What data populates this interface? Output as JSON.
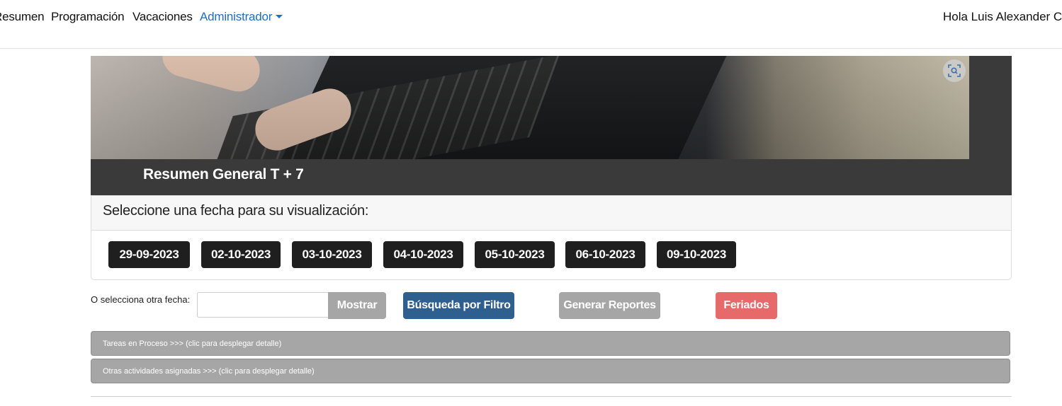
{
  "nav": {
    "items": [
      "Resumen",
      "Programación",
      "Vacaciones"
    ],
    "admin_label": "Administrador",
    "greeting": "Hola Luis Alexander Chi"
  },
  "hero": {
    "title": "Resumen General T + 7"
  },
  "date_card": {
    "title": "Seleccione una fecha para su visualización:",
    "dates": [
      "29-09-2023",
      "02-10-2023",
      "03-10-2023",
      "04-10-2023",
      "05-10-2023",
      "06-10-2023",
      "09-10-2023"
    ]
  },
  "filter": {
    "label": "O selecciona otra fecha:",
    "input_value": "",
    "show_label": "Mostrar",
    "filter_search_label": "Búsqueda por Filtro",
    "reports_label": "Generar Reportes",
    "holidays_label": "Feriados"
  },
  "accordions": [
    "Tareas en Proceso >>> (clic para desplegar detalle)",
    "Otras actividades asignadas >>> (clic para desplegar detalle)"
  ],
  "colors": {
    "nav_link_active": "#1f6fc2",
    "date_button": "#1f1f1f",
    "filter_button": "#2f5f8f",
    "holidays_button": "#e66a6a",
    "grey_button": "#a6a6a6"
  },
  "icons": {
    "zoom": "zoom-icon",
    "caret": "caret-down-icon"
  }
}
